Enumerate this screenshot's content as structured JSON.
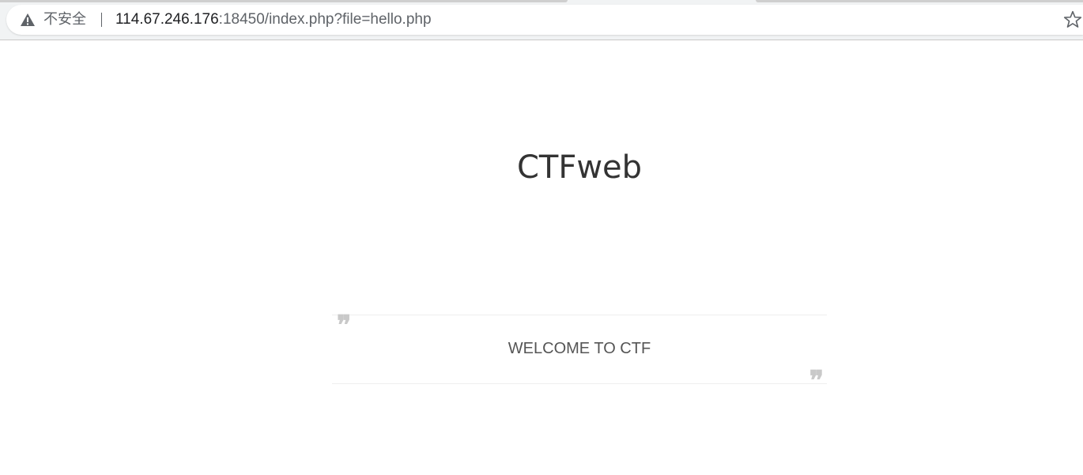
{
  "browser": {
    "security_label": "不安全",
    "url_host": "114.67.246.176",
    "url_rest": ":18450/index.php?file=hello.php",
    "icons": {
      "security": "warning-triangle-icon",
      "bookmark": "star-outline-icon"
    }
  },
  "page": {
    "title": "CTFweb",
    "quote": {
      "open_mark": "❞",
      "text": "WELCOME TO CTF",
      "close_mark": "❞"
    }
  }
}
